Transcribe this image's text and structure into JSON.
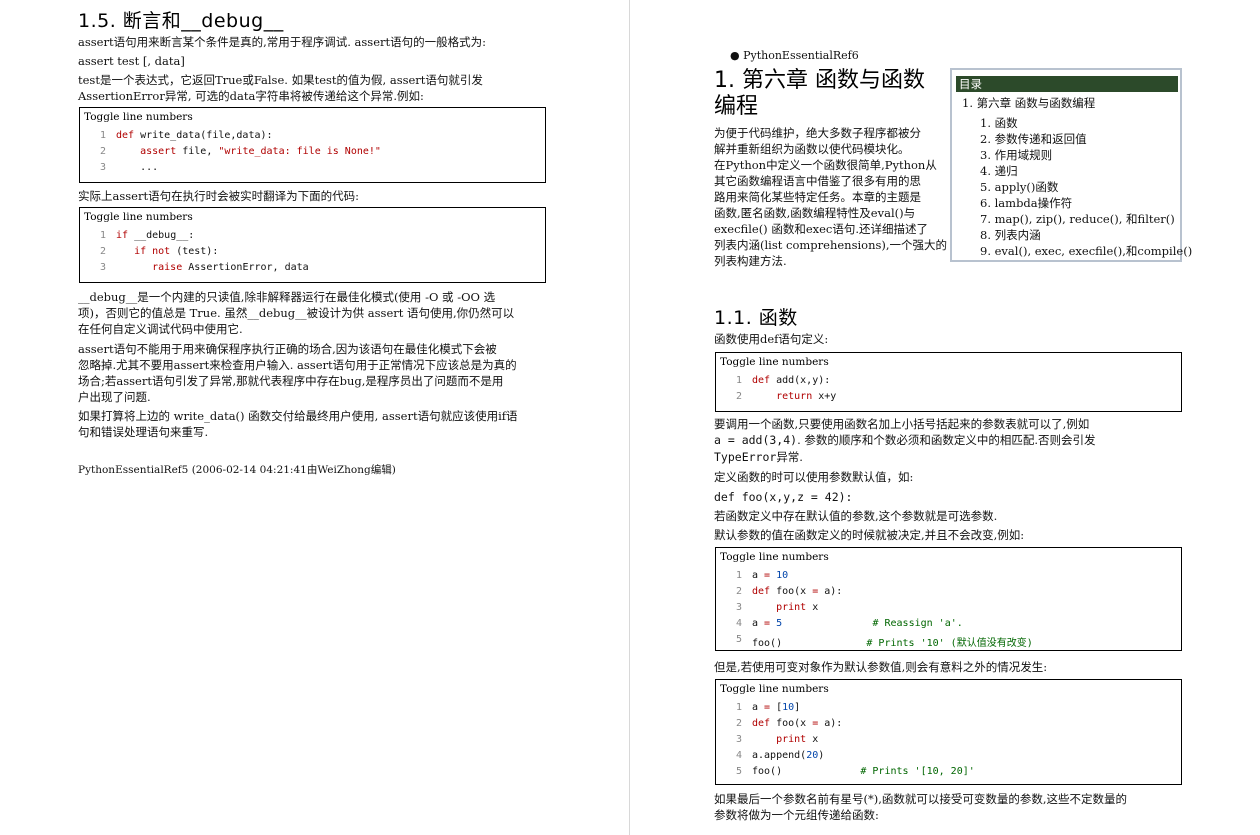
{
  "left": {
    "heading": "1.5. 断言和__debug__",
    "p1": "assert语句用来断言某个条件是真的,常用于程序调试. assert语句的一般格式为:",
    "p2": "assert test [, data]",
    "p3a": "test是一个表达式，它返回True或False. 如果test的值为假, assert语句就引发",
    "p3b": "AssertionError异常, 可选的data字符串将被传递给这个异常.例如:",
    "code1": {
      "toggle": "Toggle line numbers",
      "lines": [
        {
          "n": "1",
          "parts": [
            {
              "c": "kw",
              "t": "def"
            },
            {
              "c": "",
              "t": " write_data(file,data):"
            }
          ]
        },
        {
          "n": "2",
          "parts": [
            {
              "c": "",
              "t": "    "
            },
            {
              "c": "kw",
              "t": "assert"
            },
            {
              "c": "",
              "t": " file, "
            },
            {
              "c": "str",
              "t": "\"write_data: file is None!\""
            }
          ]
        },
        {
          "n": "3",
          "parts": [
            {
              "c": "",
              "t": "    ..."
            }
          ]
        }
      ]
    },
    "p4": "实际上assert语句在执行时会被实时翻译为下面的代码:",
    "code2": {
      "toggle": "Toggle line numbers",
      "lines": [
        {
          "n": "1",
          "parts": [
            {
              "c": "kw",
              "t": "if"
            },
            {
              "c": "",
              "t": " __debug__:"
            }
          ]
        },
        {
          "n": "2",
          "parts": [
            {
              "c": "",
              "t": "   "
            },
            {
              "c": "kw",
              "t": "if not"
            },
            {
              "c": "",
              "t": " (test):"
            }
          ]
        },
        {
          "n": "3",
          "parts": [
            {
              "c": "",
              "t": "      "
            },
            {
              "c": "kw",
              "t": "raise"
            },
            {
              "c": "",
              "t": " AssertionError, data"
            }
          ]
        }
      ]
    },
    "p5a": "__debug__是一个内建的只读值,除非解释器运行在最佳化模式(使用 -O 或 -OO 选",
    "p5b": "项)，否则它的值总是 True. 虽然__debug__被设计为供 assert 语句使用,你仍然可以",
    "p5c": "在任何自定义调试代码中使用它.",
    "p6a": "assert语句不能用于用来确保程序执行正确的场合,因为该语句在最佳化模式下会被",
    "p6b": "忽略掉.尤其不要用assert来检查用户输入. assert语句用于正常情况下应该总是为真的",
    "p6c": "场合;若assert语句引发了异常,那就代表程序中存在bug,是程序员出了问题而不是用",
    "p6d": "户出现了问题.",
    "p7a": "如果打算将上边的 write_data() 函数交付给最终用户使用, assert语句就应该使用if语",
    "p7b": "句和错误处理语句来重写.",
    "footer": "PythonEssentialRef5 (2006-02-14 04:21:41由WeiZhong编辑)"
  },
  "right": {
    "bullet": "PythonEssentialRef6",
    "heading_line1": "1. 第六章 函数与函数",
    "heading_line2": "编程",
    "intro": [
      "为便于代码维护，绝大多数子程序都被分",
      "解并重新组织为函数以使代码模块化。",
      "在Python中定义一个函数很简单,Python从",
      "其它函数编程语言中借鉴了很多有用的思",
      "路用来简化某些特定任务。本章的主题是",
      "函数,匿名函数,函数编程特性及eval()与",
      "execfile() 函数和exec语句.还详细描述了",
      "列表内涵(list comprehensions),一个强大的",
      "列表构建方法."
    ],
    "toc": {
      "title": "目录",
      "top": "1. 第六章 函数与函数编程",
      "items": [
        "1. 函数",
        "2. 参数传递和返回值",
        "3. 作用域规则",
        "4. 递归",
        "5. apply()函数",
        "6. lambda操作符",
        "7. map(), zip(), reduce(), 和filter()",
        "8. 列表内涵",
        "9. eval(), exec, execfile(),和compile()"
      ]
    },
    "sub_heading": "1.1. 函数",
    "s1": "函数使用def语句定义:",
    "code1": {
      "toggle": "Toggle line numbers",
      "lines": [
        {
          "n": "1",
          "parts": [
            {
              "c": "kw",
              "t": "def"
            },
            {
              "c": "",
              "t": " add(x,y):"
            }
          ]
        },
        {
          "n": "2",
          "parts": [
            {
              "c": "",
              "t": "    "
            },
            {
              "c": "kw",
              "t": "return"
            },
            {
              "c": "",
              "t": " x+y"
            }
          ]
        }
      ]
    },
    "s2a": "要调用一个函数,只要使用函数名加上小括号括起来的参数表就可以了,例如",
    "s2b_code": "a = add(3,4)",
    "s2b_text": ". 参数的顺序和个数必须和函数定义中的相匹配.否则会引发",
    "s2c_code": "TypeError",
    "s2c_text": "异常.",
    "s3": "定义函数的时可以使用参数默认值，如:",
    "s4_code": "def foo(x,y,z = 42):",
    "s5": "若函数定义中存在默认值的参数,这个参数就是可选参数.",
    "s6": "默认参数的值在函数定义的时候就被决定,并且不会改变,例如:",
    "code2": {
      "toggle": "Toggle line numbers",
      "lines": [
        {
          "n": "1",
          "parts": [
            {
              "c": "",
              "t": "a "
            },
            {
              "c": "kw",
              "t": "="
            },
            {
              "c": "",
              "t": " "
            },
            {
              "c": "num",
              "t": "10"
            }
          ]
        },
        {
          "n": "2",
          "parts": [
            {
              "c": "kw",
              "t": "def"
            },
            {
              "c": "",
              "t": " foo(x "
            },
            {
              "c": "kw",
              "t": "="
            },
            {
              "c": "",
              "t": " a):"
            }
          ]
        },
        {
          "n": "3",
          "parts": [
            {
              "c": "",
              "t": "    "
            },
            {
              "c": "kw",
              "t": "print"
            },
            {
              "c": "",
              "t": " x"
            }
          ]
        },
        {
          "n": "4",
          "parts": [
            {
              "c": "",
              "t": "a "
            },
            {
              "c": "kw",
              "t": "="
            },
            {
              "c": "",
              "t": " "
            },
            {
              "c": "num",
              "t": "5"
            },
            {
              "c": "",
              "t": "               "
            },
            {
              "c": "cm",
              "t": "# Reassign 'a'."
            }
          ]
        },
        {
          "n": "5",
          "parts": [
            {
              "c": "",
              "t": "foo()              "
            },
            {
              "c": "cm",
              "t": "# Prints '10' (默认值没有改变)"
            }
          ]
        }
      ]
    },
    "s7": "但是,若使用可变对象作为默认参数值,则会有意料之外的情况发生:",
    "code3": {
      "toggle": "Toggle line numbers",
      "lines": [
        {
          "n": "1",
          "parts": [
            {
              "c": "",
              "t": "a "
            },
            {
              "c": "kw",
              "t": "="
            },
            {
              "c": "",
              "t": " ["
            },
            {
              "c": "num",
              "t": "10"
            },
            {
              "c": "",
              "t": "]"
            }
          ]
        },
        {
          "n": "2",
          "parts": [
            {
              "c": "kw",
              "t": "def"
            },
            {
              "c": "",
              "t": " foo(x "
            },
            {
              "c": "kw",
              "t": "="
            },
            {
              "c": "",
              "t": " a):"
            }
          ]
        },
        {
          "n": "3",
          "parts": [
            {
              "c": "",
              "t": "    "
            },
            {
              "c": "kw",
              "t": "print"
            },
            {
              "c": "",
              "t": " x"
            }
          ]
        },
        {
          "n": "4",
          "parts": [
            {
              "c": "",
              "t": "a.append("
            },
            {
              "c": "num",
              "t": "20"
            },
            {
              "c": "",
              "t": ")"
            }
          ]
        },
        {
          "n": "5",
          "parts": [
            {
              "c": "",
              "t": "foo()             "
            },
            {
              "c": "cm",
              "t": "# Prints '[10, 20]'"
            }
          ]
        }
      ]
    },
    "s8a": "如果最后一个参数名前有星号(*),函数就可以接受可变数量的参数,这些不定数量的",
    "s8b": "参数将做为一个元组传递给函数:"
  }
}
